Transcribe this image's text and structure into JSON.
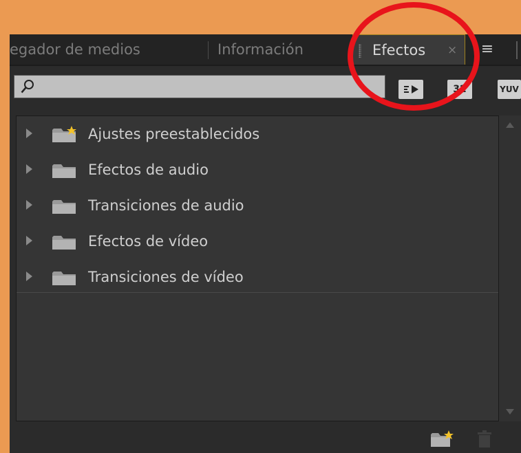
{
  "tabs": [
    {
      "label": "egador de medios"
    },
    {
      "label": "Información"
    },
    {
      "label": "Efectos",
      "close": "×"
    }
  ],
  "menu_icon": "≡",
  "search": {
    "value": "",
    "placeholder": ""
  },
  "toolbar": {
    "btn1_icon": "accelerated-effects-icon",
    "btn2_label": "32",
    "btn3_label": "YUV"
  },
  "tree": {
    "items": [
      {
        "label": "Ajustes preestablecidos",
        "icon": "folder-star-icon"
      },
      {
        "label": "Efectos de audio",
        "icon": "folder-icon"
      },
      {
        "label": "Transiciones de audio",
        "icon": "folder-icon"
      },
      {
        "label": "Efectos de vídeo",
        "icon": "folder-icon"
      },
      {
        "label": "Transiciones de vídeo",
        "icon": "folder-icon"
      }
    ]
  },
  "footer": {
    "new_bin_icon": "new-custom-bin-icon",
    "delete_icon": "trash-icon"
  },
  "colors": {
    "background": "#eb9a52",
    "panel": "#2b2b2b",
    "highlight": "#e8141b",
    "active_tab_border": "#a0821e"
  }
}
